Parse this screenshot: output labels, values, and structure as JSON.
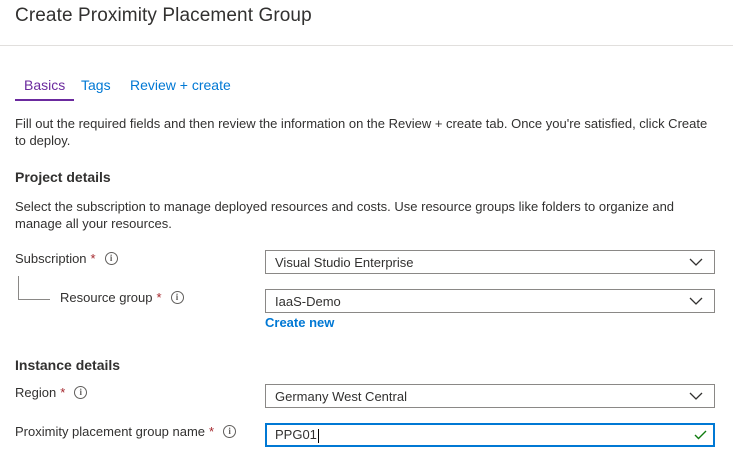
{
  "page": {
    "title": "Create Proximity Placement Group"
  },
  "tabs": [
    {
      "label": "Basics",
      "active": true
    },
    {
      "label": "Tags"
    },
    {
      "label": "Review + create"
    }
  ],
  "intro": "Fill out the required fields and then review the information on the Review + create tab. Once you're satisfied, click Create to deploy.",
  "project_details": {
    "heading": "Project details",
    "description": "Select the subscription to manage deployed resources and costs. Use resource groups like folders to organize and manage all your resources.",
    "subscription": {
      "label": "Subscription",
      "required_marker": "*",
      "value": "Visual Studio Enterprise"
    },
    "resource_group": {
      "label": "Resource group",
      "required_marker": "*",
      "value": "IaaS-Demo",
      "create_new": "Create new"
    }
  },
  "instance_details": {
    "heading": "Instance details",
    "region": {
      "label": "Region",
      "required_marker": "*",
      "value": "Germany West Central"
    },
    "ppg_name": {
      "label": "Proximity placement group name",
      "required_marker": "*",
      "value": "PPG01",
      "valid": true
    }
  },
  "icons": {
    "info": "info-icon",
    "dropdown": "chevron-down-icon",
    "validation": "checkmark-icon"
  },
  "colors": {
    "link": "#0078d4",
    "active_tab": "#6b2a9e",
    "required": "#a4262c",
    "valid": "#107c10"
  }
}
